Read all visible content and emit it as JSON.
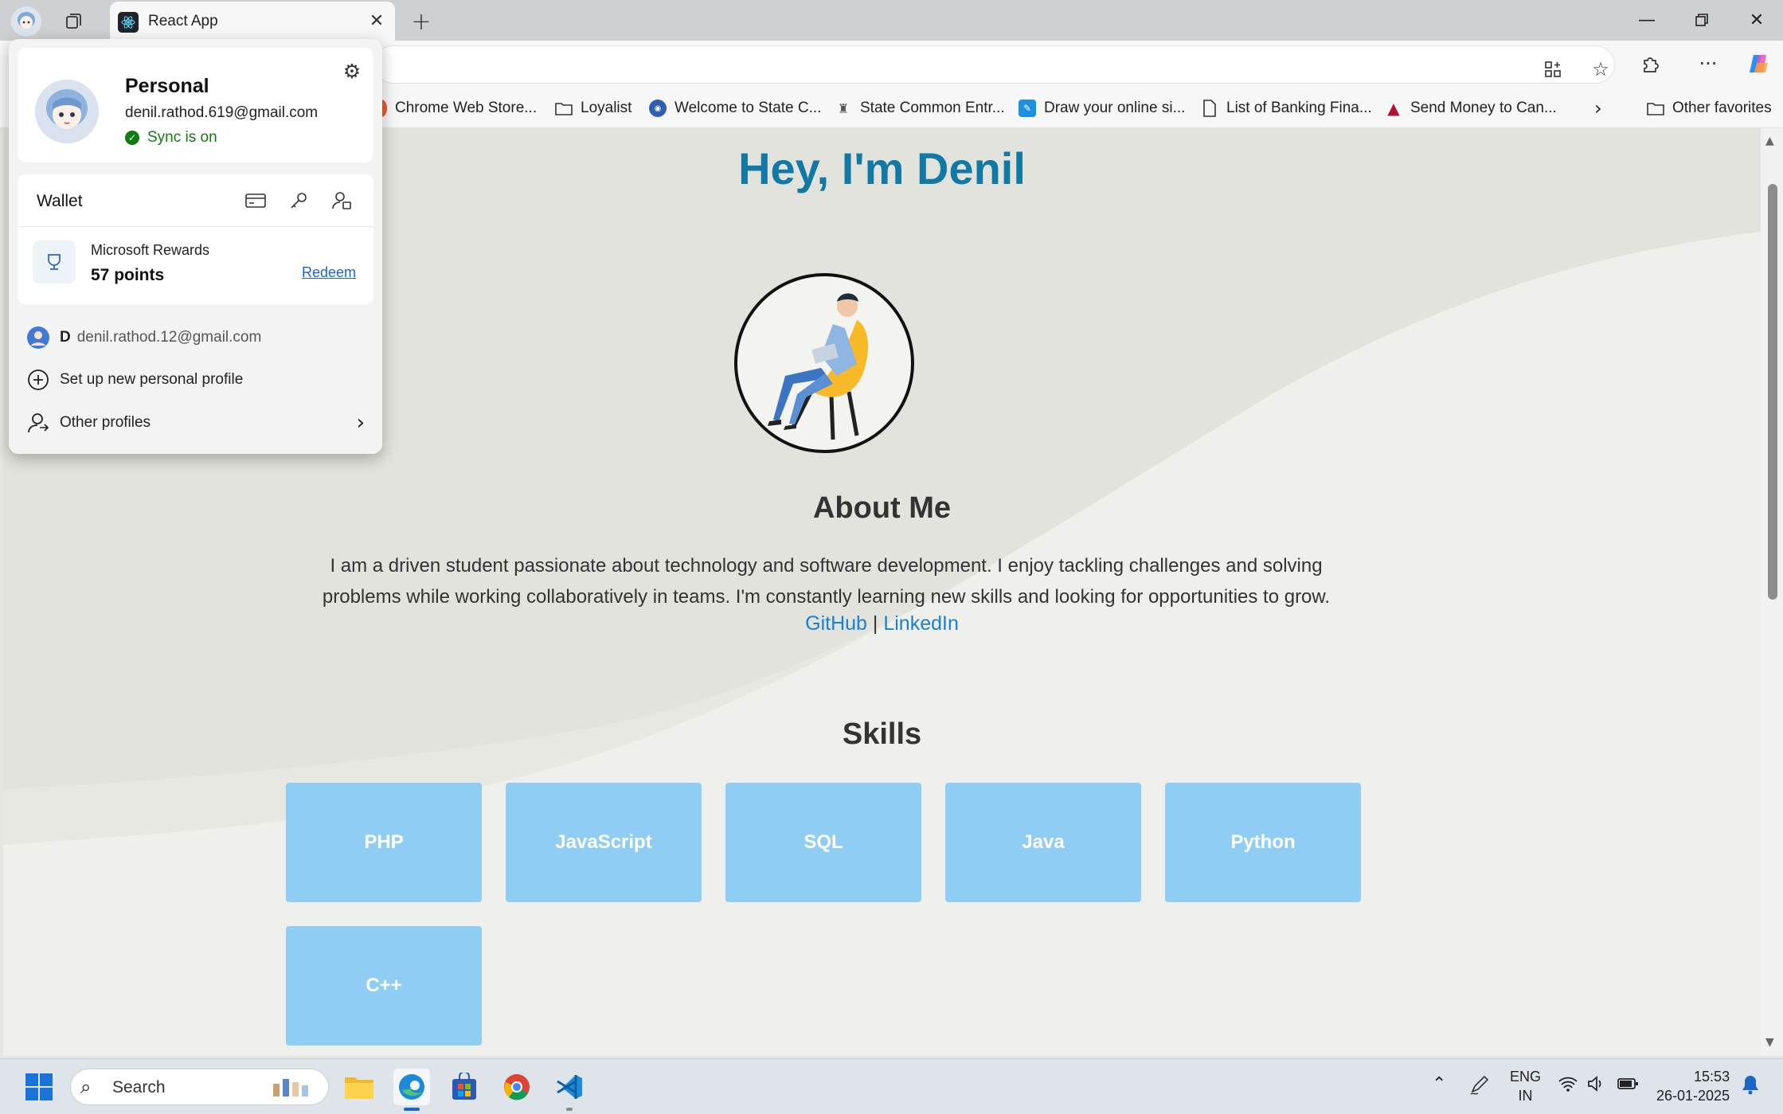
{
  "browser": {
    "tab_title": "React App",
    "favorites": [
      {
        "label": "Chrome Web Store...",
        "icon": "chrome-store-icon"
      },
      {
        "label": "Loyalist",
        "icon": "folder-icon"
      },
      {
        "label": "Welcome to State C...",
        "icon": "cet-icon"
      },
      {
        "label": "State Common Entr...",
        "icon": "emblem-icon"
      },
      {
        "label": "Draw your online si...",
        "icon": "signature-icon"
      },
      {
        "label": "List of Banking Fina...",
        "icon": "document-icon"
      },
      {
        "label": "Send Money to Can...",
        "icon": "remit-icon"
      }
    ],
    "other_favorites": "Other favorites"
  },
  "page": {
    "hero_title": "Hey, I'm Denil",
    "about_title": "About Me",
    "about_text": "I am a driven student passionate about technology and software development. I enjoy tackling challenges and solving problems while working collaboratively in teams. I'm constantly learning new skills and looking for opportunities to grow.",
    "github_label": "GitHub",
    "separator": "|",
    "linkedin_label": "LinkedIn",
    "skills_title": "Skills",
    "skills": [
      "PHP",
      "JavaScript",
      "SQL",
      "Java",
      "Python",
      "C++"
    ]
  },
  "profile": {
    "name": "Personal",
    "email": "denil.rathod.619@gmail.com",
    "sync_status": "Sync is on",
    "wallet_label": "Wallet",
    "rewards_label": "Microsoft Rewards",
    "rewards_points": "57 points",
    "redeem_label": "Redeem",
    "other_account_initial": "D",
    "other_account_email": "denil.rathod.12@gmail.com",
    "setup_label": "Set up new personal profile",
    "other_profiles_label": "Other profiles"
  },
  "taskbar": {
    "search_label": "Search",
    "language": "ENG",
    "region": "IN",
    "time": "15:53",
    "date": "26-01-2025"
  },
  "colors": {
    "hero_title": "#1179a3",
    "skill_tile": "#90cdf4",
    "link": "#1a80d0",
    "sync_green": "#107c10"
  }
}
